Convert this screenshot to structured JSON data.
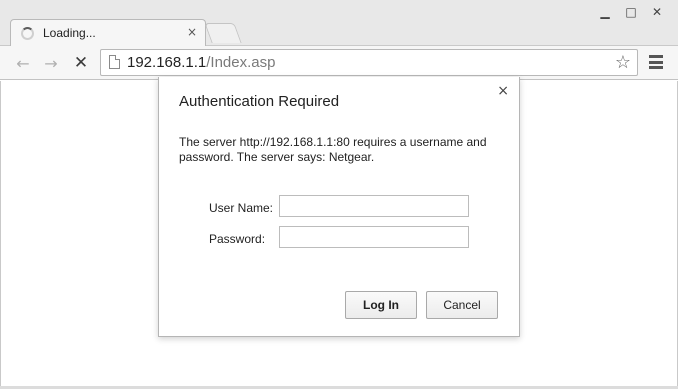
{
  "window": {
    "minimize_glyph": "▁",
    "maximize_glyph": "□",
    "close_glyph": "✕"
  },
  "tab": {
    "title": "Loading...",
    "close_glyph": "×"
  },
  "toolbar": {
    "back_glyph": "←",
    "forward_glyph": "→",
    "stop_glyph": "✕",
    "url_host": "192.168.1.1",
    "url_path": "/Index.asp",
    "star_glyph": "☆"
  },
  "dialog": {
    "title": "Authentication Required",
    "close_glyph": "×",
    "message": "The server http://192.168.1.1:80 requires a username and password. The server says: Netgear.",
    "username_label": "User Name:",
    "username_value": "",
    "password_label": "Password:",
    "password_value": "",
    "login_label": "Log In",
    "cancel_label": "Cancel"
  }
}
